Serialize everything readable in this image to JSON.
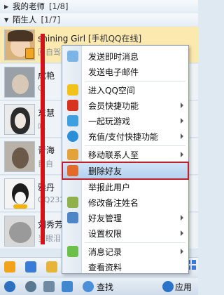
{
  "groups": [
    {
      "label": "我的老师",
      "count": "[1/8]",
      "arrow": "▶"
    },
    {
      "label": "陌生人",
      "count": "[1/7]",
      "arrow": "▼"
    }
  ],
  "contacts": [
    {
      "name": "shining Girl",
      "status": "[手机QQ在线]",
      "signature": "回自驾"
    },
    {
      "name": "成艳",
      "status": "",
      "signature": "Q"
    },
    {
      "name": "东慧",
      "status": "",
      "signature": "吃"
    },
    {
      "name": "青海",
      "status": "",
      "signature": "目自"
    },
    {
      "name": "雅丹",
      "status": "",
      "signature": "QQ232"
    },
    {
      "name": "刘秀芳",
      "status": "",
      "signature": "当眼泪"
    }
  ],
  "menu": {
    "items": [
      {
        "label": "发送即时消息",
        "icon": "chat-bubble-icon",
        "submenu": false
      },
      {
        "label": "发送电子邮件",
        "icon": "",
        "submenu": false
      },
      {
        "label": "进入QQ空间",
        "icon": "star-icon",
        "submenu": false
      },
      {
        "label": "会员快捷功能",
        "icon": "penguin-icon",
        "submenu": true
      },
      {
        "label": "一起玩游戏",
        "icon": "game-icon",
        "submenu": true
      },
      {
        "label": "充值/支付快捷功能",
        "icon": "payment-icon",
        "submenu": true
      },
      {
        "label": "移动联系人至",
        "icon": "move-contact-icon",
        "submenu": true
      },
      {
        "label": "删除好友",
        "icon": "delete-friend-icon",
        "submenu": false,
        "highlighted": true
      },
      {
        "label": "举报此用户",
        "icon": "",
        "submenu": false
      },
      {
        "label": "修改备注姓名",
        "icon": "edit-name-icon",
        "submenu": false
      },
      {
        "label": "好友管理",
        "icon": "friend-manage-icon",
        "submenu": true
      },
      {
        "label": "设置权限",
        "icon": "",
        "submenu": true
      },
      {
        "label": "消息记录",
        "icon": "message-log-icon",
        "submenu": true
      },
      {
        "label": "查看资料",
        "icon": "",
        "submenu": false
      }
    ]
  },
  "toolbar": {
    "search_label": "查找",
    "apps_label": "应用"
  },
  "colors": {
    "highlight_border": "#c0202a",
    "annotation_red": "#d0141a",
    "selected_row": "#fbe9b0"
  }
}
